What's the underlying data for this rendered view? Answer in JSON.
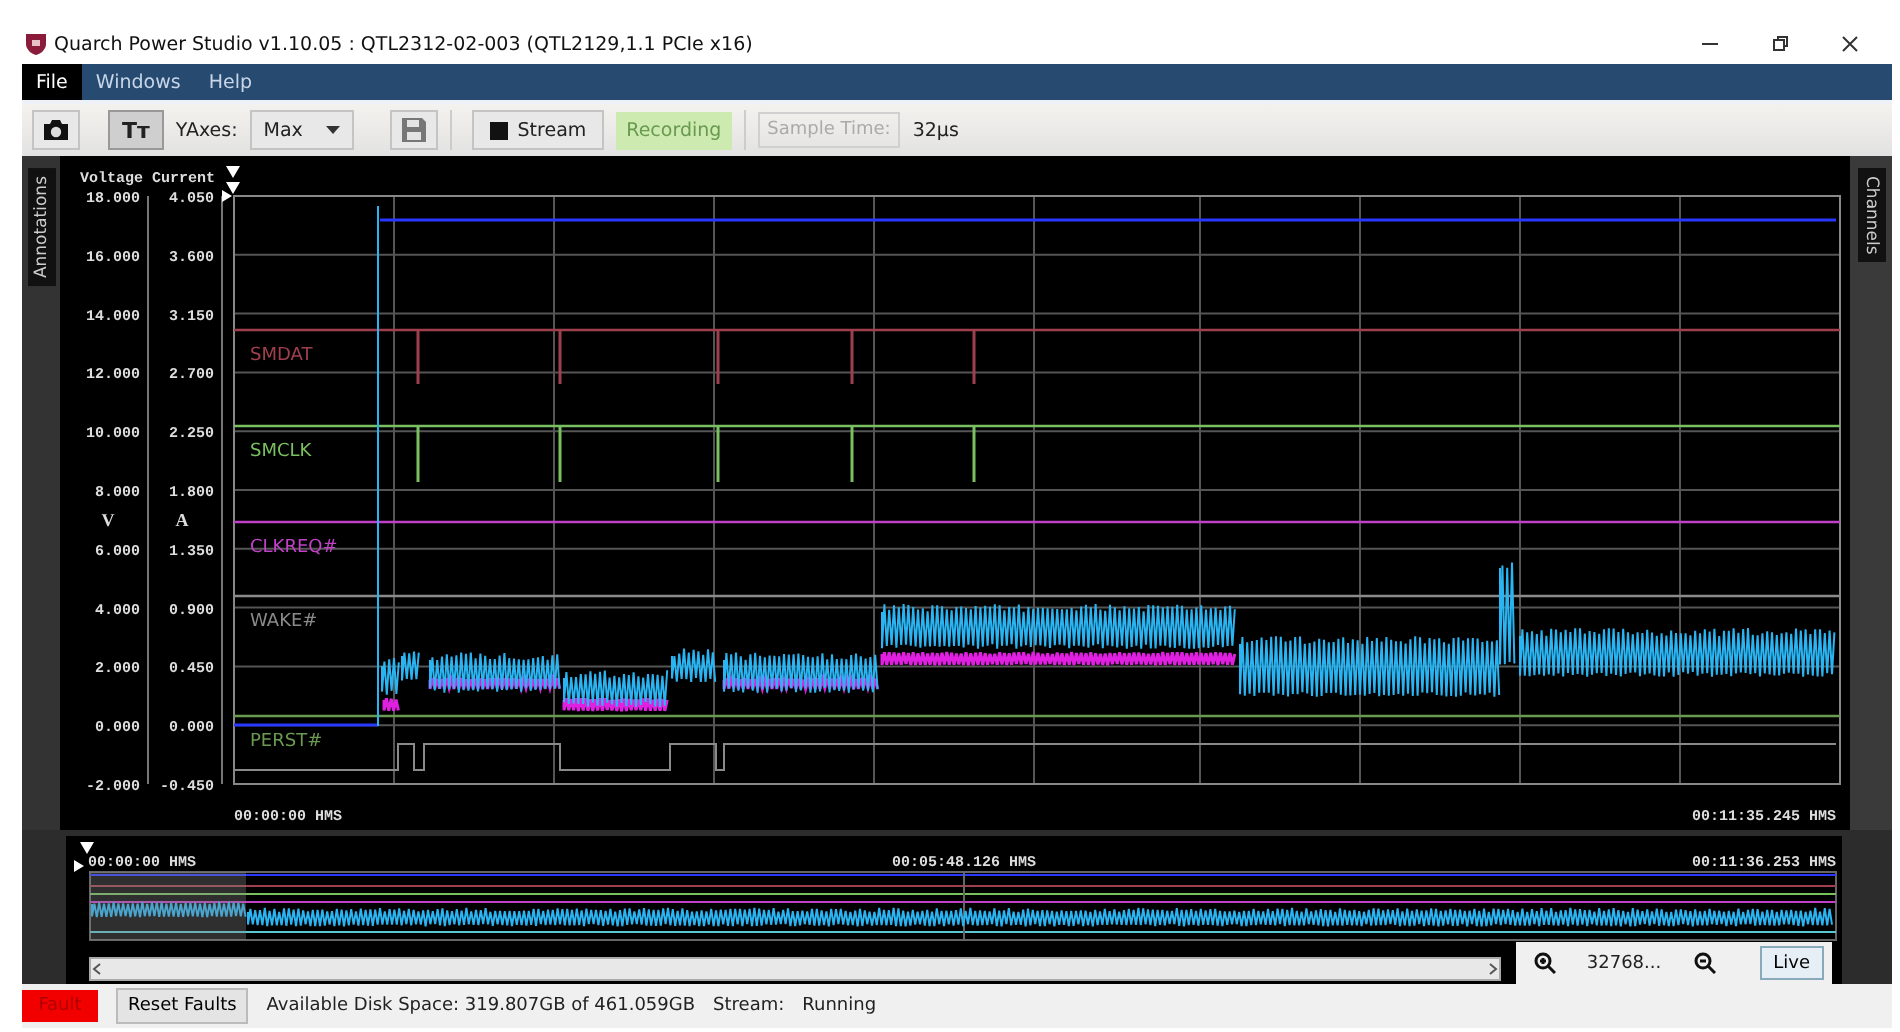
{
  "window": {
    "title": "Quarch Power Studio v1.10.05 : QTL2312-02-003 (QTL2129,1.1 PCIe x16)"
  },
  "menu": [
    {
      "label": "File",
      "selected": true
    },
    {
      "label": "Windows",
      "selected": false
    },
    {
      "label": "Help",
      "selected": false
    }
  ],
  "toolbar": {
    "text_size_button": {
      "label": "Tт",
      "pressed": true
    },
    "yaxes_label": "YAxes:",
    "yaxes_value": "Max",
    "save_disabled": true,
    "stream_button": "Stream",
    "recording_badge": "Recording",
    "sample_time_label": "Sample Time:",
    "sample_time_value": "32μs"
  },
  "side_tabs": {
    "left": "Annotations",
    "right": "Channels"
  },
  "chart": {
    "voltage_header": "Voltage",
    "current_header": "Current",
    "voltage_unit": "V",
    "current_unit": "A",
    "voltage_ticks": [
      "18.000",
      "16.000",
      "14.000",
      "12.000",
      "10.000",
      "8.000",
      "6.000",
      "4.000",
      "2.000",
      "0.000",
      "-2.000"
    ],
    "current_ticks": [
      "4.050",
      "3.600",
      "3.150",
      "2.700",
      "2.250",
      "1.800",
      "1.350",
      "0.900",
      "0.450",
      "0.000",
      "-0.450"
    ],
    "time_start": "00:00:00 HMS",
    "time_end": "00:11:35.245 HMS",
    "channels": [
      {
        "label": "SMDAT",
        "color": "#a0404e"
      },
      {
        "label": "SMCLK",
        "color": "#78c060"
      },
      {
        "label": "CLKREQ#",
        "color": "#c040c8"
      },
      {
        "label": "WAKE#",
        "color": "#8a8a8a"
      },
      {
        "label": "PERST#",
        "color": "#6a9a50"
      }
    ]
  },
  "overview": {
    "time_labels": [
      "00:00:00 HMS",
      "00:05:48.126 HMS",
      "00:11:36.253 HMS"
    ],
    "zoom_value": "32768...",
    "live_button": "Live"
  },
  "status_bar": {
    "fault": "Fault",
    "reset_button": "Reset Faults",
    "disk_space": "Available Disk Space: 319.807GB of 461.059GB",
    "stream_label": "Stream:",
    "stream_value": "Running"
  }
}
